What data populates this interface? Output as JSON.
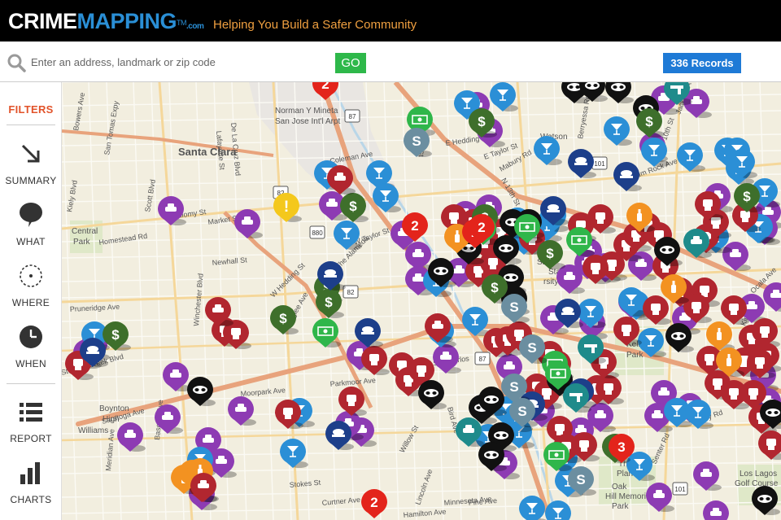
{
  "header": {
    "logo_part1": "CRIME",
    "logo_part2": "MAPPING",
    "logo_tm": "TM",
    "logo_com": ".com",
    "tagline": "Helping You Build a Safer Community"
  },
  "search": {
    "placeholder": "Enter an address, landmark or zip code",
    "value": "",
    "go_label": "GO",
    "records_label": "336 Records"
  },
  "sidebar": {
    "filters_label": "FILTERS",
    "items": [
      {
        "label": "SUMMARY",
        "icon": "arrow-down-right-icon"
      },
      {
        "label": "WHAT",
        "icon": "speech-bubble-icon"
      },
      {
        "label": "WHERE",
        "icon": "target-circle-icon"
      },
      {
        "label": "WHEN",
        "icon": "clock-icon"
      },
      {
        "label": "REPORT",
        "icon": "list-icon"
      },
      {
        "label": "CHARTS",
        "icon": "bar-chart-icon"
      }
    ]
  },
  "map": {
    "place_labels": [
      "Santa Clara",
      "Norman Y Mineta",
      "San Jose Int'l Arpt",
      "Central",
      "Park",
      "Boynton",
      "High",
      "Williams",
      "Kelley",
      "Park",
      "Oak",
      "Hill Memorial",
      "Park",
      "Los Lagos",
      "Golf Course",
      "Watson",
      "San",
      "State",
      "rsity",
      "The",
      "Plant"
    ],
    "street_labels": [
      "Bowers Ave",
      "Kiely Blvd",
      "San Tomas Expy",
      "Scott Blvd",
      "Homestead Rd",
      "Bellomy St",
      "Market St",
      "Newhall St",
      "Lafayette St",
      "De La Cruz Blvd",
      "Winchester Blvd",
      "Pruneridge Ave",
      "Stevens Creek Blvd",
      "Moorpark Ave",
      "Parkmoor Ave",
      "Saratoga Ave",
      "Bascom Ave",
      "Meridian Ave",
      "Lincoln Ave",
      "Willow St",
      "Minnesota Ave",
      "Curtner Ave",
      "Stokes St",
      "Hamilton Ave",
      "N 1st St",
      "E Taylor St",
      "E Hedding St",
      "N 13th St",
      "Coleman Ave",
      "W Taylor St",
      "The Alameda",
      "W Hedding St",
      "Naglee Ave",
      "W San Carlos",
      "Bird Ave",
      "Pine Ave",
      "S 10th St",
      "Senter Rd",
      "Story Rd",
      "Ocala Ave",
      "King Rd",
      "Jackson Ave",
      "Mabury Rd",
      "Berryessa Rd",
      "Alum Rock Ave"
    ],
    "highway_shields": [
      "87",
      "82",
      "880",
      "87",
      "101",
      "82",
      "101"
    ],
    "cluster_counts": [
      "2",
      "2",
      "2",
      "2",
      "3",
      "2"
    ]
  },
  "colors": {
    "purple": "#8d3bb3",
    "blue": "#2b8fd6",
    "green": "#2fb64a",
    "dark_red": "#b1262f",
    "black": "#111111",
    "navy": "#1d3f8a",
    "orange": "#f39221",
    "grey": "#6b8ea0",
    "teal": "#1f8b8b",
    "darkgreen": "#3e6f2b",
    "yellow": "#f4c81c",
    "cluster_red": "#e3241b"
  }
}
